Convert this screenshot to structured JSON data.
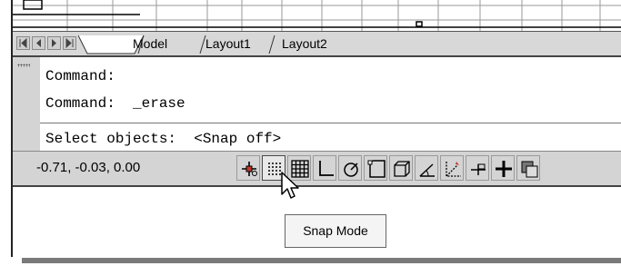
{
  "tabs": {
    "nav_first": "first-tab",
    "nav_prev": "previous-tab",
    "nav_next": "next-tab",
    "nav_last": "last-tab",
    "items": [
      {
        "label": "Model"
      },
      {
        "label": "Layout1"
      },
      {
        "label": "Layout2"
      }
    ]
  },
  "command_window": {
    "lines": [
      "Command:",
      "Command:  _erase",
      "Select objects:  <Snap off>"
    ]
  },
  "status_bar": {
    "coordinates": "-0.71, -0.03, 0.00",
    "buttons": [
      {
        "name": "infer-constraints",
        "icon": "infer-constraints-icon"
      },
      {
        "name": "snap-mode",
        "icon": "snap-mode-icon",
        "active": true
      },
      {
        "name": "grid-display",
        "icon": "grid-icon"
      },
      {
        "name": "ortho-mode",
        "icon": "ortho-icon"
      },
      {
        "name": "polar-tracking",
        "icon": "polar-icon"
      },
      {
        "name": "object-snap",
        "icon": "object-snap-icon"
      },
      {
        "name": "3d-object-snap",
        "icon": "3d-object-snap-icon"
      },
      {
        "name": "object-snap-tracking",
        "icon": "otrack-icon"
      },
      {
        "name": "dynamic-ucs",
        "icon": "dynamic-ucs-icon"
      },
      {
        "name": "dynamic-input",
        "icon": "dynamic-input-icon"
      },
      {
        "name": "lineweight",
        "icon": "lineweight-icon"
      },
      {
        "name": "transparency",
        "icon": "transparency-icon"
      }
    ]
  },
  "tooltip": {
    "text": "Snap Mode"
  }
}
